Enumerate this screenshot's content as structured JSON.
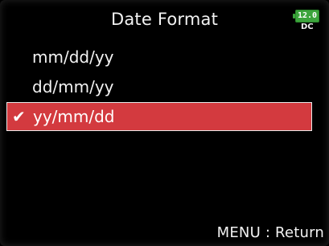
{
  "header": {
    "title": "Date Format",
    "battery_level": "12.0",
    "power_source": "DC",
    "battery_color": "#3ca43c"
  },
  "menu": {
    "items": [
      {
        "label": "mm/dd/yy",
        "selected": false
      },
      {
        "label": "dd/mm/yy",
        "selected": false
      },
      {
        "label": "yy/mm/dd",
        "selected": true
      }
    ],
    "selected_color": "#d33a3f",
    "check_icon": "checkmark-icon"
  },
  "footer": {
    "hint": "MENU : Return"
  }
}
